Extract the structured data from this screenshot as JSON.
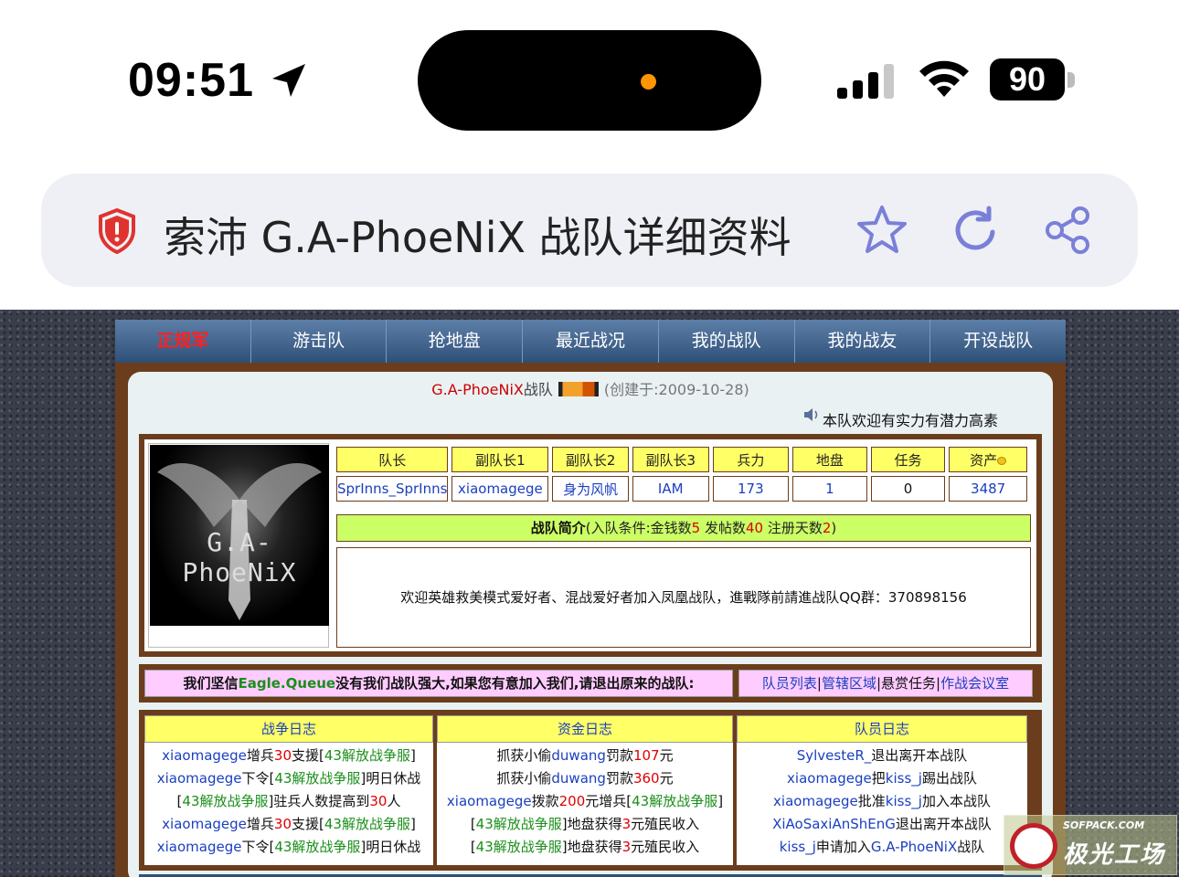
{
  "status_bar": {
    "time": "09:51",
    "battery": "90",
    "icons": [
      "location-arrow-icon",
      "cellular-signal-icon",
      "wifi-icon",
      "battery-icon"
    ]
  },
  "address_bar": {
    "title": "索沛 G.A-PhoeNiX 战队详细资料",
    "icons": [
      "shield-warning-icon",
      "star-icon",
      "reload-icon",
      "share-icon"
    ]
  },
  "colors": {
    "nav": "#2e4f78",
    "frame": "#6b3d1c",
    "header_yellow": "#ffff66",
    "intro_green": "#ccff66",
    "slogan_pink": "#ffccff",
    "link_blue": "#1a3fbf",
    "text_red": "#e00000",
    "text_green": "#1a8f1a"
  },
  "nav": {
    "items": [
      "正规军",
      "游击队",
      "抢地盘",
      "最近战况",
      "我的战队",
      "我的战友",
      "开设战队"
    ],
    "active": "正规军"
  },
  "team": {
    "name": "G.A-PhoeNiX",
    "suffix": "战队",
    "created": "(创建于:2009-10-28)",
    "welcome": "本队欢迎有实力有潜力高素",
    "logo_text": "G.A-PhoeNiX"
  },
  "stats": {
    "headers": [
      "队长",
      "副队长1",
      "副队长2",
      "副队长3",
      "兵力",
      "地盘",
      "任务",
      "资产"
    ],
    "values": [
      "SprInns_SprInns",
      "xiaomagege",
      "身为风帆",
      "IAM",
      "173",
      "1",
      "0",
      "3487"
    ]
  },
  "intro": {
    "title": "战队简介",
    "cond_prefix": "(入队条件:金钱数",
    "money": "5",
    "posts_label": "发帖数",
    "posts": "40",
    "days_label": "注册天数",
    "days": "2",
    "cond_suffix": ")",
    "body": "欢迎英雄救美模式爱好者、混战爱好者加入凤凰战队，進戰隊前請進战队QQ群：370898156"
  },
  "slogan": {
    "before": "我们坚信",
    "name": "Eagle.Queue",
    "after": "没有我们战队强大,如果您有意加入我们,请退出原来的战队:"
  },
  "links": {
    "members": "队员列表",
    "territory": "管辖区域",
    "bounty": "悬赏任务",
    "meeting": "作战会议室",
    "sep": "|"
  },
  "logs": {
    "war_title": "战争日志",
    "fund_title": "资金日志",
    "member_title": "队员日志",
    "war": [
      {
        "a": "xiaomagege",
        "b": "增兵",
        "c": "30",
        "d": "支援[",
        "e": "43解放战争服",
        "f": "]"
      },
      {
        "a": "xiaomagege",
        "b": "下令[",
        "c": "",
        "d": "",
        "e": "43解放战争服",
        "f": "]明日休战"
      },
      {
        "a": "",
        "b": "[",
        "c": "",
        "d": "",
        "e": "43解放战争服",
        "f": "]驻兵人数提高到",
        "g": "30",
        "h": "人"
      },
      {
        "a": "xiaomagege",
        "b": "增兵",
        "c": "30",
        "d": "支援[",
        "e": "43解放战争服",
        "f": "]"
      },
      {
        "a": "xiaomagege",
        "b": "下令[",
        "c": "",
        "d": "",
        "e": "43解放战争服",
        "f": "]明日休战"
      }
    ],
    "fund": [
      {
        "p1": "抓获小偷",
        "b1": "duwang",
        "p2": "罚款",
        "r1": "107",
        "p3": "元"
      },
      {
        "p1": "抓获小偷",
        "b1": "duwang",
        "p2": "罚款",
        "r1": "360",
        "p3": "元"
      },
      {
        "p1": "",
        "b1": "xiaomagege",
        "p2": "拨款",
        "r1": "200",
        "p3": "元增兵[",
        "g1": "43解放战争服",
        "p4": "]"
      },
      {
        "p1": "[",
        "b1": "",
        "p2": "",
        "g1": "43解放战争服",
        "p3": "]地盘获得",
        "r1": "3",
        "p4": "元殖民收入"
      },
      {
        "p1": "[",
        "b1": "",
        "p2": "",
        "g1": "43解放战争服",
        "p3": "]地盘获得",
        "r1": "3",
        "p4": "元殖民收入"
      }
    ],
    "member": [
      {
        "b1": "SylvesteR_",
        "p1": "退出离开本战队",
        "b2": "",
        "p2": ""
      },
      {
        "b1": "xiaomagege",
        "p1": "把",
        "b2": "kiss_j",
        "p2": "踢出战队"
      },
      {
        "b1": "xiaomagege",
        "p1": "批准",
        "b2": "kiss_j",
        "p2": "加入本战队"
      },
      {
        "b1": "XiAoSaxiAnShEnG",
        "p1": "退出离开本战队",
        "b2": "",
        "p2": ""
      },
      {
        "b1": "kiss_j",
        "p1": "申请加入",
        "b2": "G.A-PhoeNiX",
        "p2": "战队"
      }
    ]
  },
  "watermark": {
    "top": "SOFPACK.COM",
    "main": "极光工场"
  }
}
